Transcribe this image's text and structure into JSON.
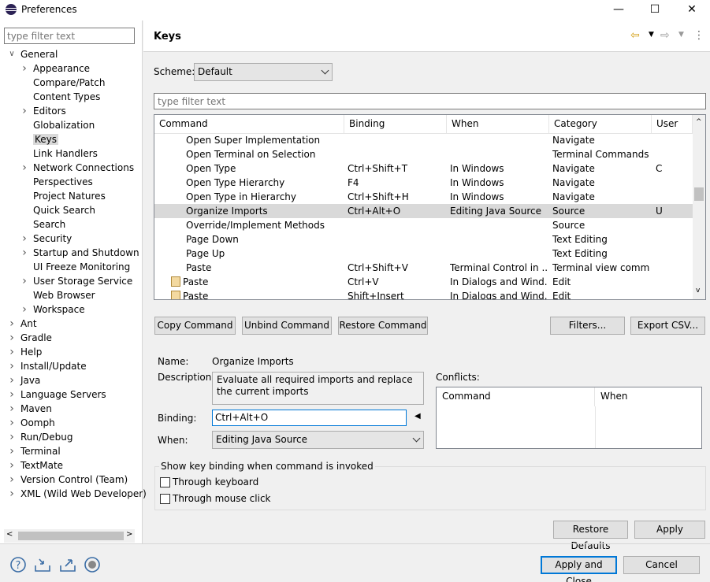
{
  "window": {
    "title": "Preferences",
    "minimize": "—",
    "maximize": "☐",
    "close": "✕"
  },
  "left": {
    "filter_placeholder": "type filter text",
    "tree": [
      {
        "label": "General",
        "twisty": "open",
        "level": 0
      },
      {
        "label": "Appearance",
        "twisty": "closed",
        "level": 1
      },
      {
        "label": "Compare/Patch",
        "twisty": "none",
        "level": 1
      },
      {
        "label": "Content Types",
        "twisty": "none",
        "level": 1
      },
      {
        "label": "Editors",
        "twisty": "closed",
        "level": 1
      },
      {
        "label": "Globalization",
        "twisty": "none",
        "level": 1
      },
      {
        "label": "Keys",
        "twisty": "none",
        "level": 1,
        "selected": true
      },
      {
        "label": "Link Handlers",
        "twisty": "none",
        "level": 1
      },
      {
        "label": "Network Connections",
        "twisty": "closed",
        "level": 1
      },
      {
        "label": "Perspectives",
        "twisty": "none",
        "level": 1
      },
      {
        "label": "Project Natures",
        "twisty": "none",
        "level": 1
      },
      {
        "label": "Quick Search",
        "twisty": "none",
        "level": 1
      },
      {
        "label": "Search",
        "twisty": "none",
        "level": 1
      },
      {
        "label": "Security",
        "twisty": "closed",
        "level": 1
      },
      {
        "label": "Startup and Shutdown",
        "twisty": "closed",
        "level": 1
      },
      {
        "label": "UI Freeze Monitoring",
        "twisty": "none",
        "level": 1
      },
      {
        "label": "User Storage Service",
        "twisty": "closed",
        "level": 1
      },
      {
        "label": "Web Browser",
        "twisty": "none",
        "level": 1
      },
      {
        "label": "Workspace",
        "twisty": "closed",
        "level": 1
      },
      {
        "label": "Ant",
        "twisty": "closed",
        "level": 0
      },
      {
        "label": "Gradle",
        "twisty": "closed",
        "level": 0
      },
      {
        "label": "Help",
        "twisty": "closed",
        "level": 0
      },
      {
        "label": "Install/Update",
        "twisty": "closed",
        "level": 0
      },
      {
        "label": "Java",
        "twisty": "closed",
        "level": 0
      },
      {
        "label": "Language Servers",
        "twisty": "closed",
        "level": 0
      },
      {
        "label": "Maven",
        "twisty": "closed",
        "level": 0
      },
      {
        "label": "Oomph",
        "twisty": "closed",
        "level": 0
      },
      {
        "label": "Run/Debug",
        "twisty": "closed",
        "level": 0
      },
      {
        "label": "Terminal",
        "twisty": "closed",
        "level": 0
      },
      {
        "label": "TextMate",
        "twisty": "closed",
        "level": 0
      },
      {
        "label": "Version Control (Team)",
        "twisty": "closed",
        "level": 0
      },
      {
        "label": "XML (Wild Web Developer)",
        "twisty": "closed",
        "level": 0
      }
    ]
  },
  "page": {
    "title": "Keys",
    "scheme_label": "Scheme:",
    "scheme_value": "Default",
    "filter_placeholder": "type filter text"
  },
  "table": {
    "headers": [
      "Command",
      "Binding",
      "When",
      "Category",
      "User"
    ],
    "rows": [
      {
        "command": "Open Super Implementation",
        "binding": "",
        "when": "",
        "category": "Navigate",
        "user": "",
        "icon": false
      },
      {
        "command": "Open Terminal on Selection",
        "binding": "",
        "when": "",
        "category": "Terminal Commands",
        "user": "",
        "icon": false
      },
      {
        "command": "Open Type",
        "binding": "Ctrl+Shift+T",
        "when": "In Windows",
        "category": "Navigate",
        "user": "C",
        "icon": false
      },
      {
        "command": "Open Type Hierarchy",
        "binding": "F4",
        "when": "In Windows",
        "category": "Navigate",
        "user": "",
        "icon": false
      },
      {
        "command": "Open Type in Hierarchy",
        "binding": "Ctrl+Shift+H",
        "when": "In Windows",
        "category": "Navigate",
        "user": "",
        "icon": false
      },
      {
        "command": "Organize Imports",
        "binding": "Ctrl+Alt+O",
        "when": "Editing Java Source",
        "category": "Source",
        "user": "U",
        "icon": false,
        "selected": true
      },
      {
        "command": "Override/Implement Methods",
        "binding": "",
        "when": "",
        "category": "Source",
        "user": "",
        "icon": false
      },
      {
        "command": "Page Down",
        "binding": "",
        "when": "",
        "category": "Text Editing",
        "user": "",
        "icon": false
      },
      {
        "command": "Page Up",
        "binding": "",
        "when": "",
        "category": "Text Editing",
        "user": "",
        "icon": false
      },
      {
        "command": "Paste",
        "binding": "Ctrl+Shift+V",
        "when": "Terminal Control in ...",
        "category": "Terminal view comm...",
        "user": "",
        "icon": false
      },
      {
        "command": "Paste",
        "binding": "Ctrl+V",
        "when": "In Dialogs and Wind...",
        "category": "Edit",
        "user": "",
        "icon": true
      },
      {
        "command": "Paste",
        "binding": "Shift+Insert",
        "when": "In Dialogs and Wind...",
        "category": "Edit",
        "user": "",
        "icon": true
      }
    ]
  },
  "buttons": {
    "copy_command": "Copy Command",
    "unbind_command": "Unbind Command",
    "restore_command": "Restore Command",
    "filters": "Filters...",
    "export_csv": "Export CSV...",
    "restore_defaults": "Restore Defaults",
    "apply": "Apply",
    "apply_and_close": "Apply and Close",
    "cancel": "Cancel"
  },
  "details": {
    "name_label": "Name:",
    "name_value": "Organize Imports",
    "description_label": "Description:",
    "description_value": "Evaluate all required imports and replace the current imports",
    "binding_label": "Binding:",
    "binding_value": "Ctrl+Alt+O",
    "when_label": "When:",
    "when_value": "Editing Java Source",
    "conflicts_label": "Conflicts:",
    "conflicts_headers": [
      "Command",
      "When"
    ]
  },
  "show_binding": {
    "title": "Show key binding when command is invoked",
    "through_keyboard": "Through keyboard",
    "through_mouse": "Through mouse click",
    "keyboard_checked": false,
    "mouse_checked": false
  },
  "colors": {
    "selection": "#d9d9d9",
    "accent": "#0078d7",
    "nav_arrow": "#d4a017"
  }
}
